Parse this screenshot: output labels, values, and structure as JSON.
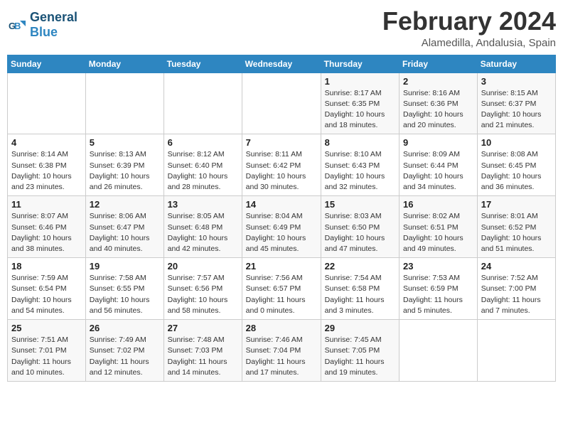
{
  "header": {
    "logo_general": "General",
    "logo_blue": "Blue",
    "month_title": "February 2024",
    "location": "Alamedilla, Andalusia, Spain"
  },
  "weekdays": [
    "Sunday",
    "Monday",
    "Tuesday",
    "Wednesday",
    "Thursday",
    "Friday",
    "Saturday"
  ],
  "weeks": [
    [
      {
        "day": "",
        "info": ""
      },
      {
        "day": "",
        "info": ""
      },
      {
        "day": "",
        "info": ""
      },
      {
        "day": "",
        "info": ""
      },
      {
        "day": "1",
        "info": "Sunrise: 8:17 AM\nSunset: 6:35 PM\nDaylight: 10 hours\nand 18 minutes."
      },
      {
        "day": "2",
        "info": "Sunrise: 8:16 AM\nSunset: 6:36 PM\nDaylight: 10 hours\nand 20 minutes."
      },
      {
        "day": "3",
        "info": "Sunrise: 8:15 AM\nSunset: 6:37 PM\nDaylight: 10 hours\nand 21 minutes."
      }
    ],
    [
      {
        "day": "4",
        "info": "Sunrise: 8:14 AM\nSunset: 6:38 PM\nDaylight: 10 hours\nand 23 minutes."
      },
      {
        "day": "5",
        "info": "Sunrise: 8:13 AM\nSunset: 6:39 PM\nDaylight: 10 hours\nand 26 minutes."
      },
      {
        "day": "6",
        "info": "Sunrise: 8:12 AM\nSunset: 6:40 PM\nDaylight: 10 hours\nand 28 minutes."
      },
      {
        "day": "7",
        "info": "Sunrise: 8:11 AM\nSunset: 6:42 PM\nDaylight: 10 hours\nand 30 minutes."
      },
      {
        "day": "8",
        "info": "Sunrise: 8:10 AM\nSunset: 6:43 PM\nDaylight: 10 hours\nand 32 minutes."
      },
      {
        "day": "9",
        "info": "Sunrise: 8:09 AM\nSunset: 6:44 PM\nDaylight: 10 hours\nand 34 minutes."
      },
      {
        "day": "10",
        "info": "Sunrise: 8:08 AM\nSunset: 6:45 PM\nDaylight: 10 hours\nand 36 minutes."
      }
    ],
    [
      {
        "day": "11",
        "info": "Sunrise: 8:07 AM\nSunset: 6:46 PM\nDaylight: 10 hours\nand 38 minutes."
      },
      {
        "day": "12",
        "info": "Sunrise: 8:06 AM\nSunset: 6:47 PM\nDaylight: 10 hours\nand 40 minutes."
      },
      {
        "day": "13",
        "info": "Sunrise: 8:05 AM\nSunset: 6:48 PM\nDaylight: 10 hours\nand 42 minutes."
      },
      {
        "day": "14",
        "info": "Sunrise: 8:04 AM\nSunset: 6:49 PM\nDaylight: 10 hours\nand 45 minutes."
      },
      {
        "day": "15",
        "info": "Sunrise: 8:03 AM\nSunset: 6:50 PM\nDaylight: 10 hours\nand 47 minutes."
      },
      {
        "day": "16",
        "info": "Sunrise: 8:02 AM\nSunset: 6:51 PM\nDaylight: 10 hours\nand 49 minutes."
      },
      {
        "day": "17",
        "info": "Sunrise: 8:01 AM\nSunset: 6:52 PM\nDaylight: 10 hours\nand 51 minutes."
      }
    ],
    [
      {
        "day": "18",
        "info": "Sunrise: 7:59 AM\nSunset: 6:54 PM\nDaylight: 10 hours\nand 54 minutes."
      },
      {
        "day": "19",
        "info": "Sunrise: 7:58 AM\nSunset: 6:55 PM\nDaylight: 10 hours\nand 56 minutes."
      },
      {
        "day": "20",
        "info": "Sunrise: 7:57 AM\nSunset: 6:56 PM\nDaylight: 10 hours\nand 58 minutes."
      },
      {
        "day": "21",
        "info": "Sunrise: 7:56 AM\nSunset: 6:57 PM\nDaylight: 11 hours\nand 0 minutes."
      },
      {
        "day": "22",
        "info": "Sunrise: 7:54 AM\nSunset: 6:58 PM\nDaylight: 11 hours\nand 3 minutes."
      },
      {
        "day": "23",
        "info": "Sunrise: 7:53 AM\nSunset: 6:59 PM\nDaylight: 11 hours\nand 5 minutes."
      },
      {
        "day": "24",
        "info": "Sunrise: 7:52 AM\nSunset: 7:00 PM\nDaylight: 11 hours\nand 7 minutes."
      }
    ],
    [
      {
        "day": "25",
        "info": "Sunrise: 7:51 AM\nSunset: 7:01 PM\nDaylight: 11 hours\nand 10 minutes."
      },
      {
        "day": "26",
        "info": "Sunrise: 7:49 AM\nSunset: 7:02 PM\nDaylight: 11 hours\nand 12 minutes."
      },
      {
        "day": "27",
        "info": "Sunrise: 7:48 AM\nSunset: 7:03 PM\nDaylight: 11 hours\nand 14 minutes."
      },
      {
        "day": "28",
        "info": "Sunrise: 7:46 AM\nSunset: 7:04 PM\nDaylight: 11 hours\nand 17 minutes."
      },
      {
        "day": "29",
        "info": "Sunrise: 7:45 AM\nSunset: 7:05 PM\nDaylight: 11 hours\nand 19 minutes."
      },
      {
        "day": "",
        "info": ""
      },
      {
        "day": "",
        "info": ""
      }
    ]
  ]
}
